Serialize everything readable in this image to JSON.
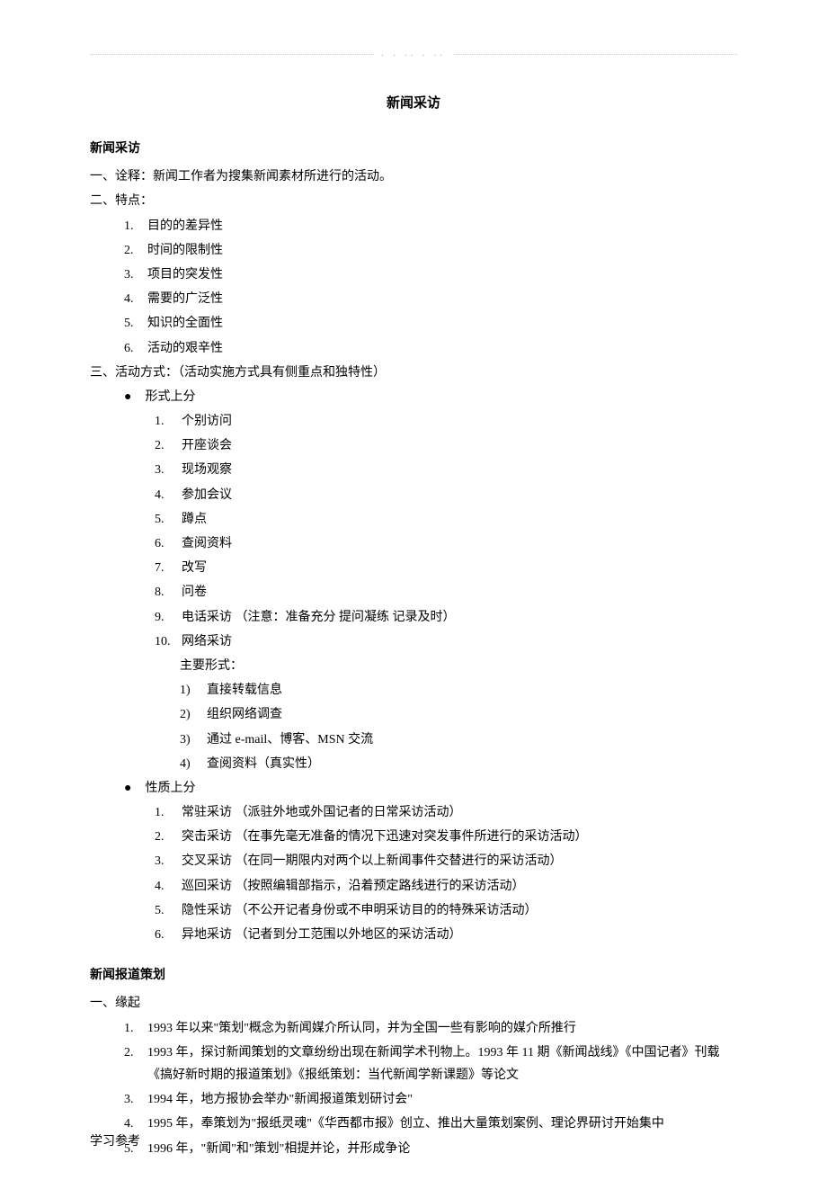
{
  "header_dots": ". . .. . ..",
  "title": "新闻采访",
  "section1": {
    "heading": "新闻采访",
    "one": {
      "label": "一、",
      "title": "诠释：",
      "text": "新闻工作者为搜集新闻素材所进行的活动。"
    },
    "two": {
      "label": "二、",
      "title": "特点：",
      "items": [
        {
          "n": "1.",
          "t": "目的的差异性"
        },
        {
          "n": "2.",
          "t": "时间的限制性"
        },
        {
          "n": "3.",
          "t": "项目的突发性"
        },
        {
          "n": "4.",
          "t": "需要的广泛性"
        },
        {
          "n": "5.",
          "t": "知识的全面性"
        },
        {
          "n": "6.",
          "t": "活动的艰辛性"
        }
      ]
    },
    "three": {
      "label": "三、",
      "title": "活动方式：（活动实施方式具有侧重点和独特性）",
      "g1": {
        "label": "形式上分",
        "items": [
          {
            "n": "1.",
            "t": "个别访问"
          },
          {
            "n": "2.",
            "t": "开座谈会"
          },
          {
            "n": "3.",
            "t": "现场观察"
          },
          {
            "n": "4.",
            "t": "参加会议"
          },
          {
            "n": "5.",
            "t": "蹲点"
          },
          {
            "n": "6.",
            "t": "查阅资料"
          },
          {
            "n": "7.",
            "t": "改写"
          },
          {
            "n": "8.",
            "t": "问卷"
          },
          {
            "n": "9.",
            "t": "电话采访  （注意：准备充分  提问凝练  记录及时）"
          },
          {
            "n": "10.",
            "t": "网络采访"
          }
        ],
        "sub_label": "主要形式：",
        "sub_items": [
          {
            "n": "1)",
            "t": "直接转载信息"
          },
          {
            "n": "2)",
            "t": "组织网络调查"
          },
          {
            "n": "3)",
            "t": "通过 e-mail、博客、MSN 交流"
          },
          {
            "n": "4)",
            "t": "查阅资料（真实性）"
          }
        ]
      },
      "g2": {
        "label": "性质上分",
        "items": [
          {
            "n": "1.",
            "t": "常驻采访  （派驻外地或外国记者的日常采访活动）"
          },
          {
            "n": "2.",
            "t": "突击采访  （在事先毫无准备的情况下迅速对突发事件所进行的采访活动）"
          },
          {
            "n": "3.",
            "t": "交叉采访  （在同一期限内对两个以上新闻事件交替进行的采访活动）"
          },
          {
            "n": "4.",
            "t": "巡回采访  （按照编辑部指示，沿着预定路线进行的采访活动）"
          },
          {
            "n": "5.",
            "t": "隐性采访  （不公开记者身份或不申明采访目的的特殊采访活动）"
          },
          {
            "n": "6.",
            "t": "异地采访  （记者到分工范围以外地区的采访活动）"
          }
        ]
      }
    }
  },
  "section2": {
    "heading": "新闻报道策划",
    "one": {
      "label": "一、",
      "title": "缘起",
      "items": [
        {
          "n": "1.",
          "t": "1993 年以来\"策划\"概念为新闻媒介所认同，并为全国一些有影响的媒介所推行"
        },
        {
          "n": "2.",
          "t": "1993 年，探讨新闻策划的文章纷纷出现在新闻学术刊物上。1993 年 11 期《新闻战线》《中国记者》刊载《搞好新时期的报道策划》《报纸策划：当代新闻学新课题》等论文"
        },
        {
          "n": "3.",
          "t": "1994 年，地方报协会举办\"新闻报道策划研讨会\""
        },
        {
          "n": "4.",
          "t": "1995 年，奉策划为\"报纸灵魂\"《华西都市报》创立、推出大量策划案例、理论界研讨开始集中"
        },
        {
          "n": "5.",
          "t": "1996 年，\"新闻\"和\"策划\"相提并论，并形成争论"
        }
      ]
    }
  },
  "footer": "学习参考"
}
